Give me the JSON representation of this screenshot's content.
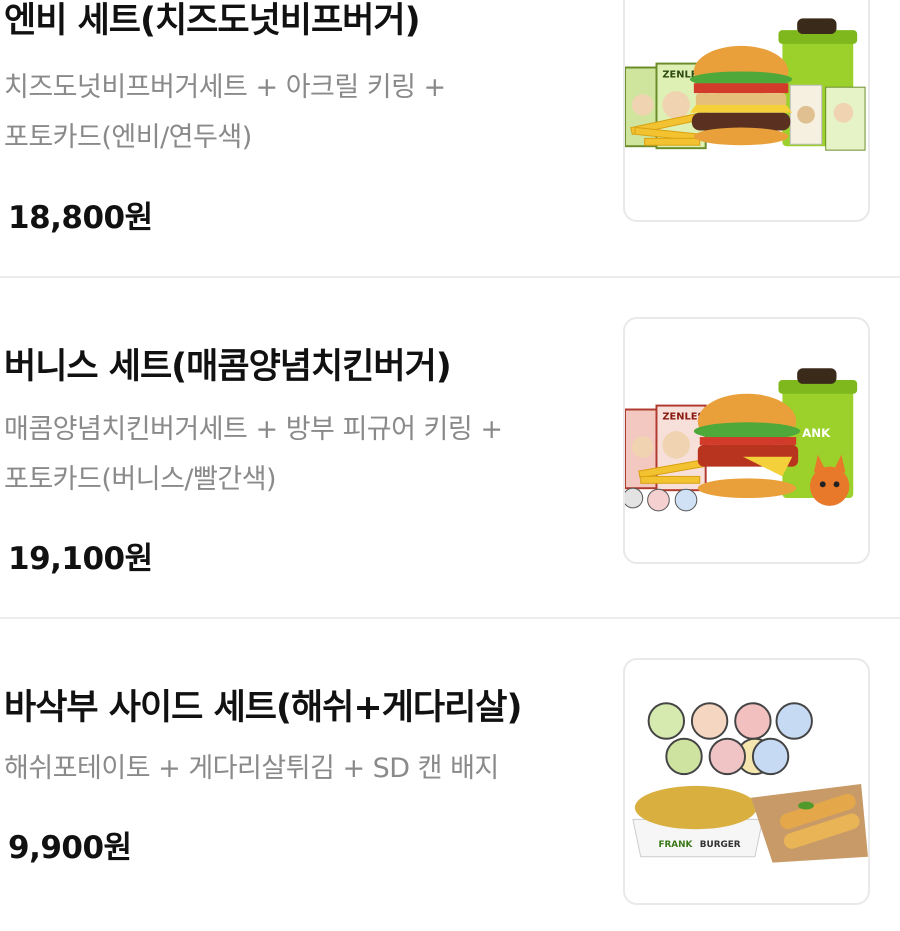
{
  "menu": {
    "items": [
      {
        "title": "엔비 세트(치즈도넛비프버거)",
        "desc_line1": "치즈도넛비프버거세트 + 아크릴 키링 +",
        "desc_line2": "포토카드(엔비/연두색)",
        "price": "18,800원"
      },
      {
        "title": "버니스 세트(매콤양념치킨버거)",
        "desc_line1": "매콤양념치킨버거세트 + 방부 피규어 키링 +",
        "desc_line2": "포토카드(버니스/빨간색)",
        "price": "19,100원"
      },
      {
        "title": "바삭부 사이드 세트(해쉬+게다리살)",
        "desc_line1": "해쉬포테이토 + 게다리살튀김 + SD 캔 배지",
        "desc_line2": "",
        "price": "9,900원"
      }
    ]
  },
  "images": {
    "set1": {
      "cup_text": "",
      "card_text": "ZENLESS"
    },
    "set2": {
      "cup_text": "ANK",
      "card_text": "ZENLESS"
    },
    "set3": {
      "box_text": "FRANK",
      "box_text2": "BURGER"
    }
  }
}
